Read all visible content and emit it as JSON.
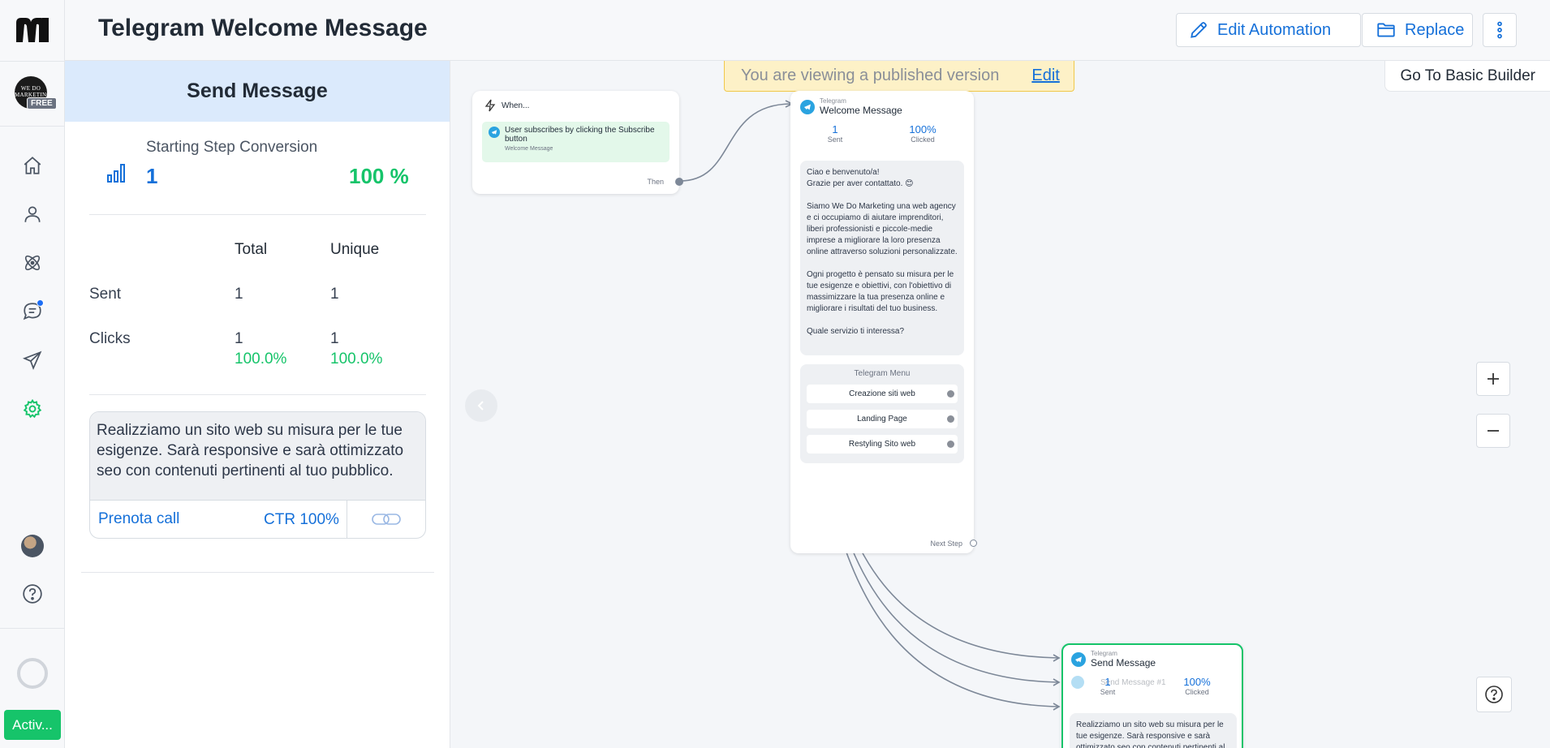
{
  "app": {
    "logo_icon": "manychat-logo",
    "account_badge": "FREE",
    "account_text": "WE DO MARKETING",
    "activate_label": "Activ...",
    "accent_color": "#1570d9",
    "success_color": "#16c46a"
  },
  "sidebar": {
    "items": [
      {
        "name": "home-icon"
      },
      {
        "name": "contacts-icon"
      },
      {
        "name": "automation-icon"
      },
      {
        "name": "live-chat-icon",
        "has_notification": true
      },
      {
        "name": "broadcast-icon"
      },
      {
        "name": "settings-icon"
      }
    ]
  },
  "header": {
    "title": "Telegram Welcome Message",
    "edit_automation_label": "Edit Automation",
    "replace_label": "Replace"
  },
  "panel": {
    "title": "Send Message",
    "conversion_label": "Starting Step Conversion",
    "conversion_value": "1",
    "conversion_pct": "100 %",
    "col_total": "Total",
    "col_unique": "Unique",
    "rows": [
      {
        "label": "Sent",
        "total": "1",
        "unique": "1"
      },
      {
        "label": "Clicks",
        "total": "1",
        "unique": "1",
        "total_pct": "100.0%",
        "unique_pct": "100.0%"
      }
    ],
    "message_text": "Realizziamo un sito web su misura per le tue esigenze. Sarà responsive e sarà ottimizzato seo con contenuti pertinenti al tuo pubblico.",
    "button_label": "Prenota call",
    "button_ctr": "CTR 100%"
  },
  "canvas": {
    "banner_text": "You are viewing a published version",
    "banner_edit": "Edit",
    "basic_builder_label": "Go To Basic Builder",
    "trigger_node": {
      "header": "When...",
      "trigger_text": "User subscribes by clicking the Subscribe button",
      "trigger_sub": "Welcome Message",
      "then_label": "Then"
    },
    "welcome_node": {
      "channel": "Telegram",
      "title": "Welcome Message",
      "sent_value": "1",
      "sent_label": "Sent",
      "clicked_value": "100%",
      "clicked_label": "Clicked",
      "message": "Ciao e benvenuto/a!\nGrazie per aver contattato. 😊\n\nSiamo We Do Marketing una web agency e ci occupiamo di aiutare imprenditori, liberi professionisti e piccole-medie imprese a migliorare la loro presenza online attraverso soluzioni personalizzate.\n\nOgni progetto è pensato su misura per le tue esigenze e obiettivi, con l'obiettivo di massimizzare la tua presenza online e migliorare i risultati del tuo business.\n\nQuale servizio ti interessa?",
      "menu_title": "Telegram Menu",
      "menu_items": [
        "Creazione siti web",
        "Landing Page",
        "Restyling Sito web"
      ],
      "next_step_label": "Next Step"
    },
    "send_node": {
      "channel": "Telegram",
      "title": "Send Message",
      "sent_value": "1",
      "sent_label": "Sent",
      "clicked_value": "100%",
      "clicked_label": "Clicked",
      "faded_1": "Send Message #1",
      "message": "Realizziamo un sito web su misura per le tue esigenze. Sarà responsive e sarà ottimizzato seo con contenuti pertinenti al tuo pubblico."
    }
  }
}
